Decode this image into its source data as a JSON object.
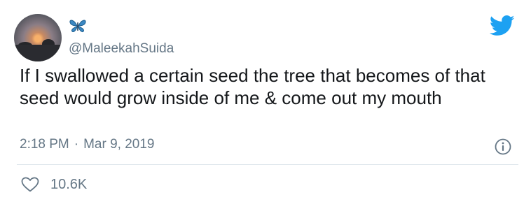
{
  "user": {
    "handle": "@MaleekahSuida",
    "avatar_icon": "sunset-avatar",
    "badge_icon": "butterfly-icon",
    "badge_color": "#3b88c3"
  },
  "tweet": {
    "text": "If I swallowed a certain seed the tree that becomes of that seed would grow inside of me & come out my mouth",
    "time": "2:18 PM",
    "separator": "·",
    "date": "Mar 9, 2019"
  },
  "stats": {
    "likes": "10.6K"
  },
  "icons": {
    "brand": "twitter-bird-icon",
    "info": "info-icon",
    "like": "heart-icon"
  },
  "colors": {
    "twitter_blue": "#1da1f2",
    "secondary_text": "#657786",
    "divider": "#e1e8ed"
  }
}
